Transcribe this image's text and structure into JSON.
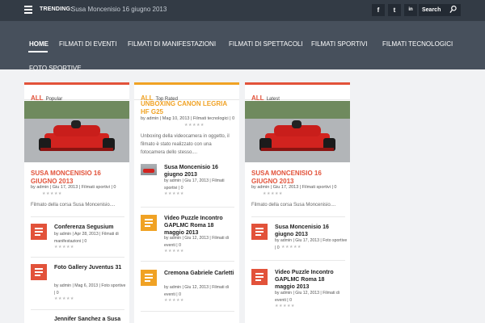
{
  "topbar": {
    "trending_label": "TRENDING:",
    "trending_text": "Susa Moncenisio 16 giugno 2013",
    "social": [
      "f",
      "t",
      "in"
    ],
    "search_placeholder": "Search"
  },
  "nav": {
    "items": [
      "HOME",
      "FILMATI DI EVENTI",
      "FILMATI DI MANIFESTAZIONI",
      "FILMATI DI SPETTACOLI",
      "FILMATI SPORTIVI",
      "FILMATI TECNOLOGICI",
      "FOTO SPORTIVE"
    ],
    "active": "HOME"
  },
  "colors": {
    "red": "#e2523a",
    "orange": "#f0a224",
    "topbar": "#333b45",
    "nav": "#47505c"
  },
  "columns": [
    {
      "all": "ALL",
      "label": "Popular",
      "accent": "#e2523a",
      "featured": {
        "title": "SUSA MONCENISIO 16 GIUGNO 2013",
        "meta": "by admin | Giu 17, 2013 | Filmati sportivi | 0",
        "excerpt": "Filmato della corsa Susa Moncenisio...."
      },
      "items": [
        {
          "title": "Conferenza Segusium",
          "meta": "by admin | Apr 28, 2013 | Filmati di manifestazioni | 0"
        },
        {
          "title": "Foto Gallery Juventus 31",
          "meta": "by admin | Mag 6, 2013 | Foto sportive | 0"
        },
        {
          "title": "Jennifer Sanchez a Susa",
          "meta": ""
        }
      ]
    },
    {
      "all": "ALL",
      "label": "Top Rated",
      "accent": "#f0a224",
      "featured": {
        "title": "UNBOXING CANON LEGRIA HF G25",
        "meta": "by admin | Mag 10, 2013 | Filmati tecnologici | 0",
        "excerpt": "Unboxing della videocamera in oggetto, il filmato è stato realizzato con una fotocamera dello stesso...."
      },
      "items": [
        {
          "title": "Susa Moncenisio 16 giugno 2013",
          "meta": "by admin | Giu 17, 2013 | Filmati sportivi | 0"
        },
        {
          "title": "Video Puzzle Incontro GAPLMC Roma 18 maggio 2013",
          "meta": "by admin | Giu 12, 2013 | Filmati di eventi | 0"
        },
        {
          "title": "Cremona Gabriele Carletti",
          "meta": "by admin | Giu 12, 2013 | Filmati di eventi | 0"
        }
      ]
    },
    {
      "all": "ALL",
      "label": "Latest",
      "accent": "#e2523a",
      "featured": {
        "title": "SUSA MONCENISIO 16 GIUGNO 2013",
        "meta": "by admin | Giu 17, 2013 | Filmati sportivi | 0",
        "excerpt": "Filmato della corsa Susa Moncenisio...."
      },
      "items": [
        {
          "title": "Susa Moncenisio 16 giugno 2013",
          "meta": "by admin | Giu 17, 2013 | Foto sportive | 0"
        },
        {
          "title": "Video Puzzle Incontro GAPLMC Roma 18 maggio 2013",
          "meta": "by admin | Giu 12, 2013 | Filmati di eventi | 0"
        }
      ]
    }
  ]
}
